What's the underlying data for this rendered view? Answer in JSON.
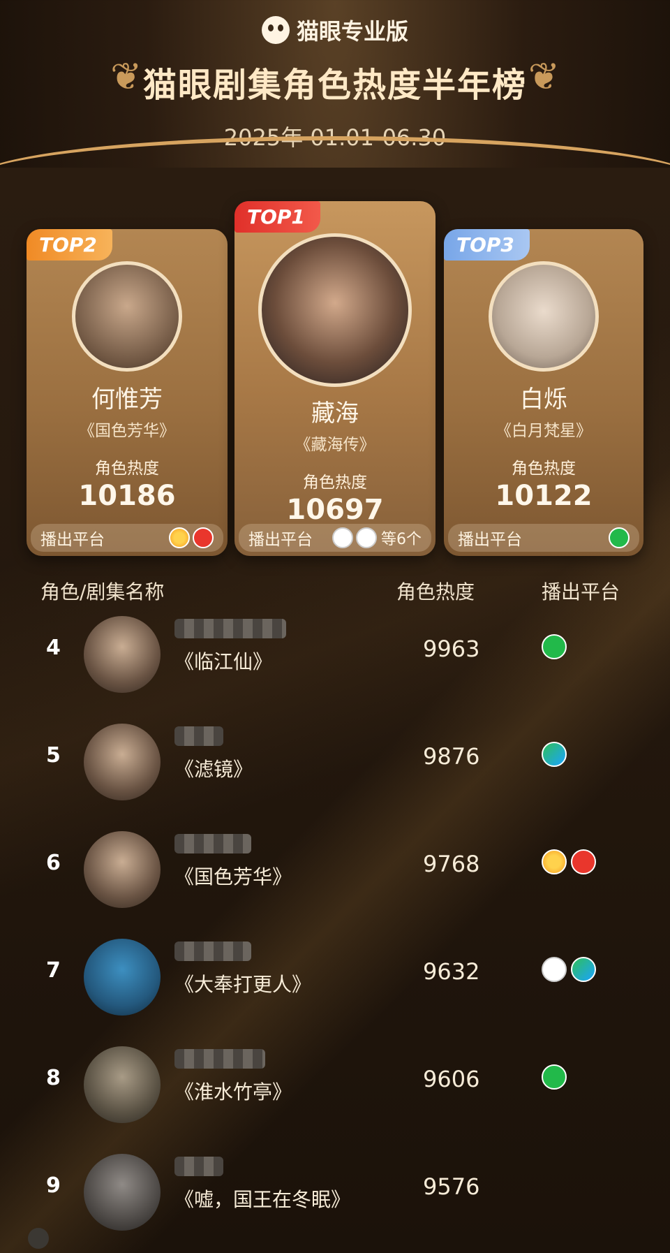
{
  "brand": {
    "name": "猫眼专业版",
    "icon": "cat-icon"
  },
  "title": "猫眼剧集角色热度半年榜",
  "date_range": "2025年 01.01-06.30",
  "top3": [
    {
      "tag": "TOP2",
      "name": "何惟芳",
      "show": "《国色芳华》",
      "heat_label": "角色热度",
      "heat": "10186",
      "platform_label": "播出平台",
      "platforms": [
        "mango-tv",
        "youku"
      ]
    },
    {
      "tag": "TOP1",
      "name": "藏海",
      "show": "《藏海传》",
      "heat_label": "角色热度",
      "heat": "10697",
      "platform_label": "播出平台",
      "platforms": [
        "cctv",
        "cctv"
      ],
      "platforms_more": "等6个"
    },
    {
      "tag": "TOP3",
      "name": "白烁",
      "show": "《白月梵星》",
      "heat_label": "角色热度",
      "heat": "10122",
      "platform_label": "播出平台",
      "platforms": [
        "iqiyi"
      ]
    }
  ],
  "list_header": {
    "col1": "角色/剧集名称",
    "col2": "角色热度",
    "col3": "播出平台"
  },
  "rows": [
    {
      "rank": "4",
      "show": "《临江仙》",
      "heat": "9963",
      "platforms": [
        "iqiyi"
      ]
    },
    {
      "rank": "5",
      "show": "《滤镜》",
      "heat": "9876",
      "platforms": [
        "tencent"
      ]
    },
    {
      "rank": "6",
      "show": "《国色芳华》",
      "heat": "9768",
      "platforms": [
        "mango-tv",
        "youku"
      ]
    },
    {
      "rank": "7",
      "show": "《大奉打更人》",
      "heat": "9632",
      "platforms": [
        "cctv",
        "tencent"
      ]
    },
    {
      "rank": "8",
      "show": "《淮水竹亭》",
      "heat": "9606",
      "platforms": [
        "iqiyi"
      ]
    },
    {
      "rank": "9",
      "show": "《嘘，国王在冬眠》",
      "heat": "9576",
      "platforms": []
    }
  ],
  "colors": {
    "gold": "#d7a460",
    "card": "#a77846",
    "tag_top1": "#e0302a",
    "tag_top2": "#f08a25",
    "tag_top3": "#78a6e8"
  }
}
